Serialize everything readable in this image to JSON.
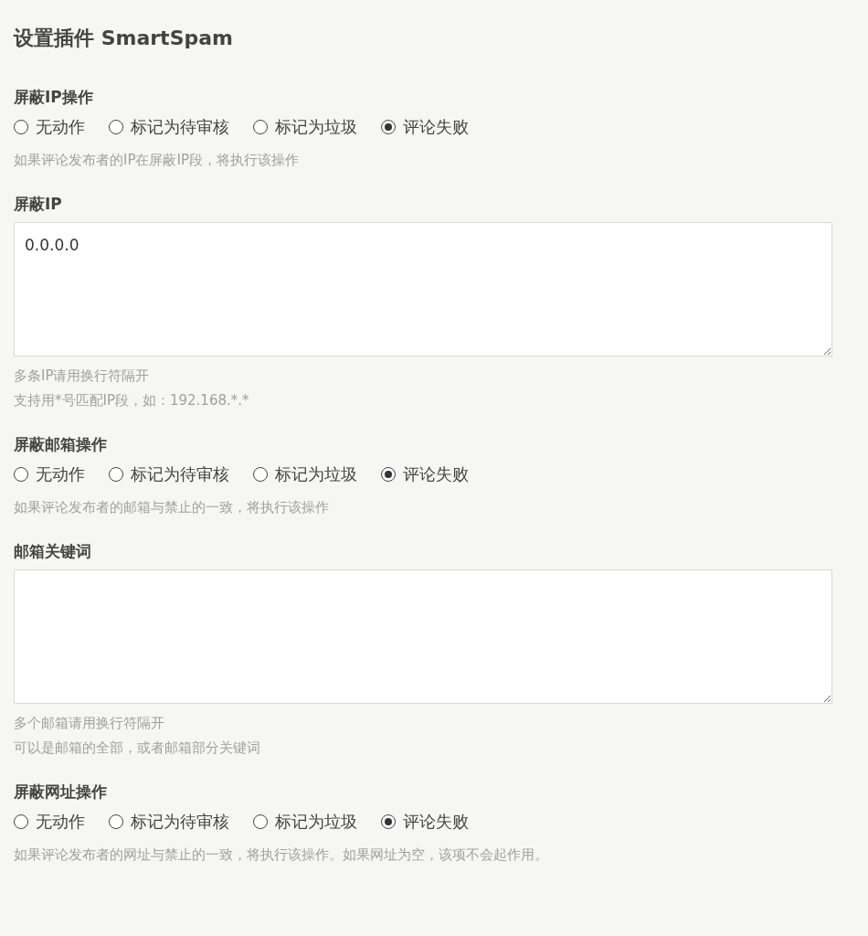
{
  "title": "设置插件 SmartSpam",
  "sections": [
    {
      "kind": "radio",
      "label": "屏蔽IP操作",
      "options": [
        {
          "label": "无动作",
          "selected": false
        },
        {
          "label": "标记为待审核",
          "selected": false
        },
        {
          "label": "标记为垃圾",
          "selected": false
        },
        {
          "label": "评论失败",
          "selected": true
        }
      ],
      "help": [
        "如果评论发布者的IP在屏蔽IP段，将执行该操作"
      ]
    },
    {
      "kind": "textarea",
      "label": "屏蔽IP",
      "value": "0.0.0.0",
      "help": [
        "多条IP请用换行符隔开",
        "支持用*号匹配IP段，如：192.168.*.*"
      ]
    },
    {
      "kind": "radio",
      "label": "屏蔽邮箱操作",
      "options": [
        {
          "label": "无动作",
          "selected": false
        },
        {
          "label": "标记为待审核",
          "selected": false
        },
        {
          "label": "标记为垃圾",
          "selected": false
        },
        {
          "label": "评论失败",
          "selected": true
        }
      ],
      "help": [
        "如果评论发布者的邮箱与禁止的一致，将执行该操作"
      ]
    },
    {
      "kind": "textarea",
      "label": "邮箱关键词",
      "help": [
        "多个邮箱请用换行符隔开",
        "可以是邮箱的全部，或者邮箱部分关键词"
      ]
    },
    {
      "kind": "radio",
      "label": "屏蔽网址操作",
      "options": [
        {
          "label": "无动作",
          "selected": false
        },
        {
          "label": "标记为待审核",
          "selected": false
        },
        {
          "label": "标记为垃圾",
          "selected": false
        },
        {
          "label": "评论失败",
          "selected": true
        }
      ],
      "help": [
        "如果评论发布者的网址与禁止的一致，将执行该操作。如果网址为空，该项不会起作用。"
      ]
    }
  ]
}
